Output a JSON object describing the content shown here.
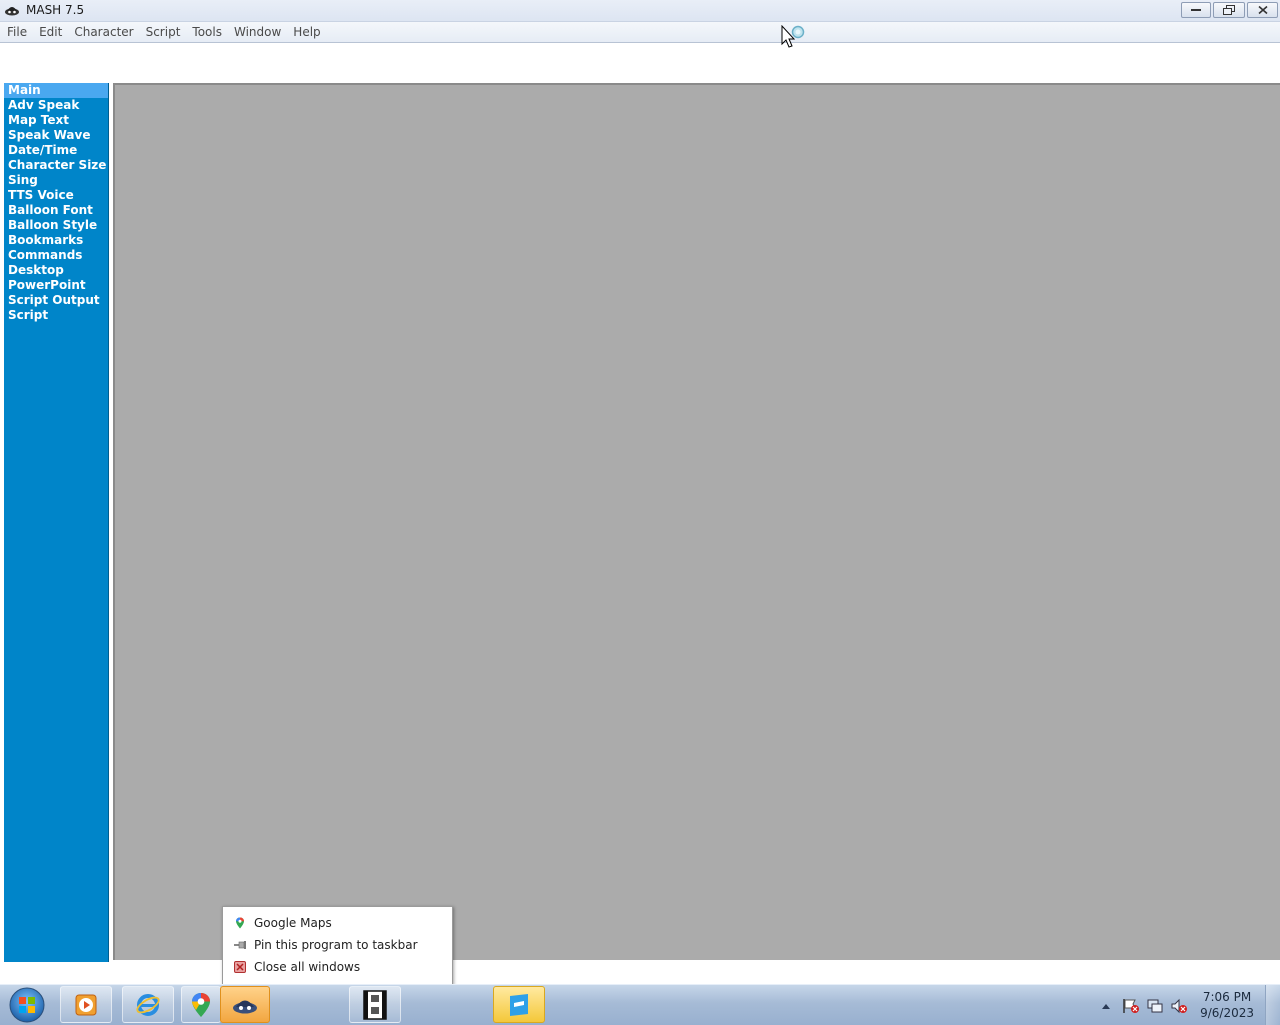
{
  "window": {
    "title": "MASH 7.5",
    "icon": "mash-app-icon",
    "controls": [
      "minimize-icon",
      "restore-icon",
      "close-icon"
    ]
  },
  "menubar": {
    "items": [
      "File",
      "Edit",
      "Character",
      "Script",
      "Tools",
      "Window",
      "Help"
    ]
  },
  "sidebar": {
    "items": [
      {
        "label": "Main",
        "active": true
      },
      {
        "label": "Adv Speak"
      },
      {
        "label": "Map Text"
      },
      {
        "label": "Speak Wave"
      },
      {
        "label": "Date/Time"
      },
      {
        "label": "Character Size"
      },
      {
        "label": "Sing"
      },
      {
        "label": "TTS Voice"
      },
      {
        "label": "Balloon Font"
      },
      {
        "label": "Balloon Style"
      },
      {
        "label": "Bookmarks"
      },
      {
        "label": "Commands"
      },
      {
        "label": "Desktop"
      },
      {
        "label": "PowerPoint"
      },
      {
        "label": "Script Output"
      },
      {
        "label": "Script"
      }
    ],
    "colors": {
      "background": "#0085c9",
      "active": "#4aa8f0",
      "text": "#ffffff"
    }
  },
  "workspace": {
    "background": "#ababab"
  },
  "jumplist": {
    "items": [
      {
        "label": "Google Maps",
        "icon": "google-maps-icon"
      },
      {
        "label": "Pin this program to taskbar",
        "icon": "pin-icon"
      },
      {
        "label": "Close all windows",
        "icon": "close-windows-icon"
      }
    ]
  },
  "taskbar": {
    "buttons": [
      "start-orb-icon",
      "media-player-icon",
      "internet-explorer-icon",
      "google-maps-icon",
      "mash-app-icon",
      "film-strip-icon",
      "roblox-studio-icon"
    ],
    "tray": [
      "show-hidden-icons-icon",
      "action-center-flag-icon",
      "network-icon",
      "volume-muted-icon"
    ],
    "clock": {
      "time": "7:06 PM",
      "date": "9/6/2023"
    }
  }
}
